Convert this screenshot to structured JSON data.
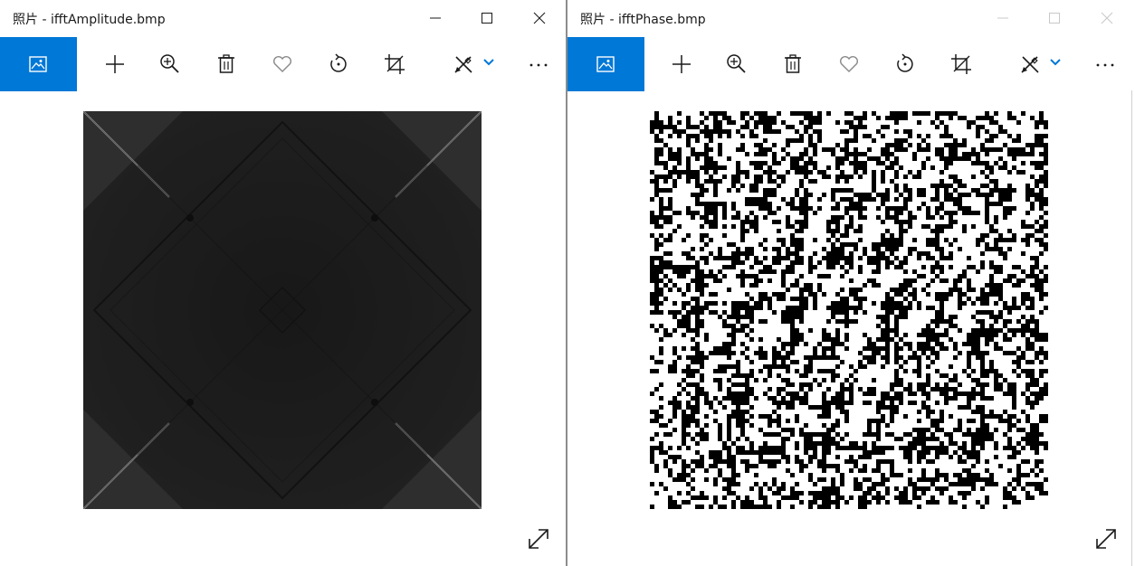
{
  "windows": [
    {
      "title": "照片 - ifftAmplitude.bmp",
      "active": true,
      "toolbar": [
        "view-photo-icon",
        "add-icon",
        "zoom-in-icon",
        "delete-icon",
        "favorite-icon",
        "rotate-icon",
        "crop-icon",
        "edit-draw-icon",
        "chevron-down-icon",
        "more-icon"
      ],
      "window_controls": [
        "minimize",
        "maximize",
        "close"
      ],
      "image_name": "ifftAmplitude.bmp"
    },
    {
      "title": "照片 - ifftPhase.bmp",
      "active": false,
      "toolbar": [
        "view-photo-icon",
        "add-icon",
        "zoom-in-icon",
        "delete-icon",
        "favorite-icon",
        "rotate-icon",
        "crop-icon",
        "edit-draw-icon",
        "chevron-down-icon",
        "more-icon"
      ],
      "window_controls": [
        "minimize",
        "maximize",
        "close"
      ],
      "image_name": "ifftPhase.bmp"
    }
  ],
  "colors": {
    "accent": "#0078d7",
    "icon": "#1a1a1a",
    "icon_muted": "#8a8a8a"
  }
}
